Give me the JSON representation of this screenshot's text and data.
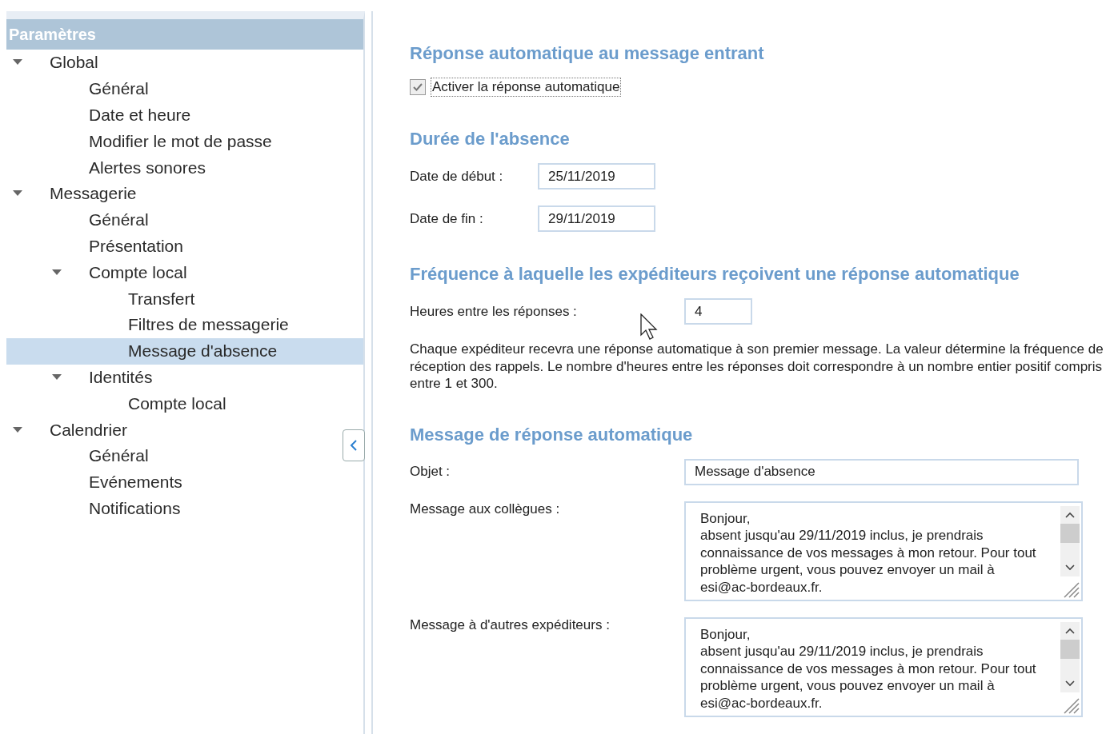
{
  "sidebar": {
    "title": "Paramètres",
    "tree": [
      {
        "label": "Global",
        "expanded": true,
        "selected": false,
        "children": [
          {
            "label": "Général",
            "selected": false
          },
          {
            "label": "Date et heure",
            "selected": false
          },
          {
            "label": "Modifier le mot de passe",
            "selected": false
          },
          {
            "label": "Alertes sonores",
            "selected": false
          }
        ]
      },
      {
        "label": "Messagerie",
        "expanded": true,
        "selected": false,
        "children": [
          {
            "label": "Général",
            "selected": false
          },
          {
            "label": "Présentation",
            "selected": false
          },
          {
            "label": "Compte local",
            "expanded": true,
            "selected": false,
            "children": [
              {
                "label": "Transfert",
                "selected": false
              },
              {
                "label": "Filtres de messagerie",
                "selected": false
              },
              {
                "label": "Message d'absence",
                "selected": true
              }
            ]
          },
          {
            "label": "Identités",
            "expanded": true,
            "selected": false,
            "children": [
              {
                "label": "Compte local",
                "selected": false
              }
            ]
          }
        ]
      },
      {
        "label": "Calendrier",
        "expanded": true,
        "selected": false,
        "children": [
          {
            "label": "Général",
            "selected": false
          },
          {
            "label": "Evénements",
            "selected": false
          },
          {
            "label": "Notifications",
            "selected": false
          }
        ]
      }
    ]
  },
  "sections": [
    {
      "title": "Réponse automatique au message entrant",
      "checkbox": {
        "label": "Activer la réponse automatique",
        "checked": true
      }
    },
    {
      "title": "Durée de l'absence",
      "fields": [
        {
          "label": "Date de début :",
          "value": "25/11/2019"
        },
        {
          "label": "Date de fin :",
          "value": "29/11/2019"
        }
      ]
    },
    {
      "title": "Fréquence à laquelle les expéditeurs reçoivent une réponse automatique",
      "fields": [
        {
          "label": "Heures entre les réponses :",
          "value": "4"
        }
      ],
      "note": "Chaque expéditeur recevra une réponse automatique à son premier message. La valeur détermine la fréquence de réception des rappels. Le nombre d'heures entre les réponses doit correspondre à un nombre entier positif compris entre 1 et 300."
    },
    {
      "title": "Message de réponse automatique",
      "fields": [
        {
          "label": "Objet :",
          "value": "Message d'absence"
        }
      ],
      "messages": [
        {
          "label": "Message aux collègues :",
          "lines": [
            "Bonjour,",
            "absent jusqu'au 29/11/2019 inclus, je prendrais",
            "connaissance de vos messages à mon retour. Pour tout",
            "problème urgent, vous pouvez envoyer un mail à",
            "esi@ac-bordeaux.fr."
          ]
        },
        {
          "label": "Message à d'autres expéditeurs :",
          "lines": [
            "Bonjour,",
            "absent jusqu'au 29/11/2019 inclus, je prendrais",
            "connaissance de vos messages à mon retour. Pour tout",
            "problème urgent, vous pouvez envoyer un mail à",
            "esi@ac-bordeaux.fr."
          ]
        }
      ]
    }
  ]
}
